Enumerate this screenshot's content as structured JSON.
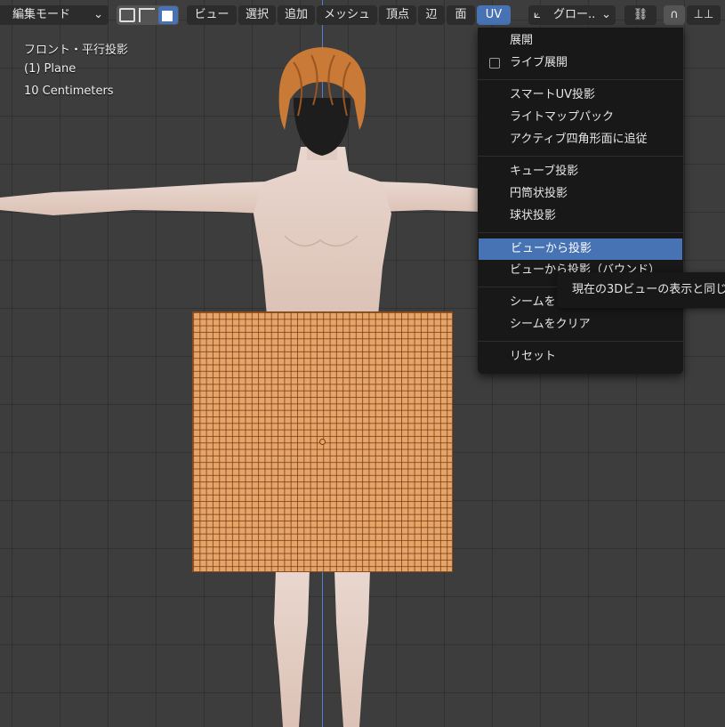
{
  "toolbar": {
    "mode_select": "編集モード",
    "menus": [
      "ビュー",
      "選択",
      "追加",
      "メッシュ",
      "頂点",
      "辺",
      "面",
      "UV"
    ],
    "transform_orientation": "グロー..",
    "active_menu": "UV"
  },
  "viewport": {
    "view_name": "フロント・平行投影",
    "object_name": "(1) Plane",
    "scale": "10 Centimeters"
  },
  "uv_menu": {
    "items": [
      {
        "label": "展開"
      },
      {
        "label": "ライブ展開",
        "checkbox": true
      },
      {
        "label": "スマートUV投影"
      },
      {
        "label": "ライトマップパック"
      },
      {
        "label": "アクティブ四角形面に追従"
      },
      {
        "label": "キューブ投影"
      },
      {
        "label": "円筒状投影"
      },
      {
        "label": "球状投影"
      },
      {
        "label": "ビューから投影",
        "highlighted": true
      },
      {
        "label": "ビューから投影（バウンド）"
      },
      {
        "label": "シームをマーク"
      },
      {
        "label": "シームをクリア"
      },
      {
        "label": "リセット"
      }
    ]
  },
  "tooltip": {
    "text": "現在の3Dビューの表示と同じ"
  },
  "colors": {
    "accent": "#4772b3",
    "plane": "#e6a468",
    "menu_bg": "#181818"
  }
}
